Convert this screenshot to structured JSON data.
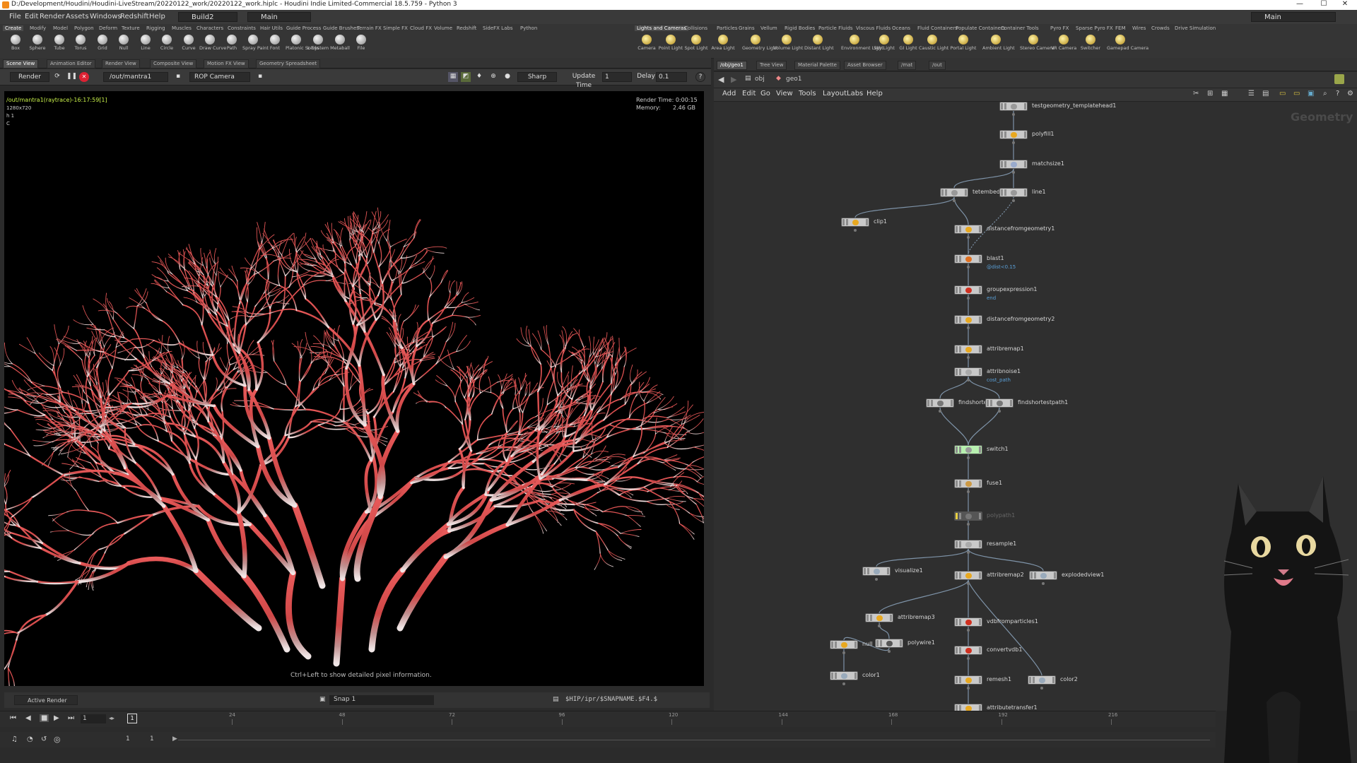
{
  "window": {
    "title": "D:/Development/Houdini/Houdini-LiveStream/20220122_work/20220122_work.hiplc - Houdini Indie Limited-Commercial 18.5.759 - Python 3",
    "minimize": "—",
    "maximize": "☐",
    "close": "✕"
  },
  "menubar": {
    "items": [
      "File",
      "Edit",
      "Render",
      "Assets",
      "Windows",
      "Redshift",
      "Help"
    ],
    "build_combo": "Build2",
    "desktop_combo": "Main",
    "right_combo": "Main"
  },
  "shelf_left": {
    "tabs": [
      "Create",
      "Modify",
      "Model",
      "Polygon",
      "Deform",
      "Texture",
      "Rigging",
      "Muscles",
      "Characters",
      "Constraints",
      "Hair Utils",
      "Guide Process",
      "Guide Brushes",
      "Terrain FX",
      "Simple FX",
      "Cloud FX",
      "Volume",
      "Redshift",
      "SideFX Labs",
      "Python"
    ],
    "tools": [
      "Box",
      "Sphere",
      "Tube",
      "Torus",
      "Grid",
      "Null",
      "Line",
      "Circle",
      "Curve",
      "Draw Curve",
      "Path",
      "Spray Paint",
      "Font",
      "Platonic Solids",
      "L-System",
      "Metaball",
      "File"
    ]
  },
  "shelf_right": {
    "tabs": [
      "Lights and Cameras",
      "Collisions",
      "Particles",
      "Grains",
      "Vellum",
      "Rigid Bodies",
      "Particle Fluids",
      "Viscous Fluids",
      "Oceans",
      "Fluid Containers",
      "Populate Containers",
      "Container Tools",
      "Pyro FX",
      "Sparse Pyro FX",
      "FEM",
      "Wires",
      "Crowds",
      "Drive Simulation"
    ],
    "tools": [
      "Camera",
      "Point Light",
      "Spot Light",
      "Area Light",
      "Geometry Light",
      "Volume Light",
      "Distant Light",
      "Environment Light",
      "Sky Light",
      "GI Light",
      "Caustic Light",
      "Portal Light",
      "Ambient Light",
      "Stereo Camera",
      "VR Camera",
      "Switcher",
      "Gamepad Camera"
    ]
  },
  "left_pane_tabs": [
    "Scene View",
    "Animation Editor",
    "Render View",
    "Composite View",
    "Motion FX View",
    "Geometry Spreadsheet"
  ],
  "viewer_toolbar": {
    "render_button": "Render",
    "output_combo": "/out/mantra1",
    "camera_combo": "ROP Camera",
    "sharp_combo": "Sharp",
    "update_time_label": "Update Time",
    "update_time_value": "1",
    "delay_label": "Delay",
    "delay_value": "0.1",
    "help": "?"
  },
  "viewport": {
    "render_path": "/out/mantra1(raytrace)-16:17:59[1]",
    "resolution": "1280x720",
    "h_line": "h 1",
    "c_line": "C",
    "render_time": "Render Time: 0:00:15",
    "memory_label": "Memory:",
    "memory_value": "2.46 GB",
    "hint": "Ctrl+Left to show detailed pixel information."
  },
  "viewer_bottom": {
    "active_render": "Active Render",
    "snap": "Snap 1",
    "snapname": "$HIP/ipr/$SNAPNAME.$F4.$"
  },
  "right_pane_tabs": [
    "/obj/geo1",
    "Tree View",
    "Material Palette",
    "Asset Browser",
    "/mat",
    "/out"
  ],
  "network": {
    "path_obj": "obj",
    "path_geo": "geo1",
    "menu": [
      "Add",
      "Edit",
      "Go",
      "View",
      "Tools",
      "Layout",
      "Labs",
      "Help"
    ],
    "context_label": "Geometry",
    "nodes": [
      "testgeometry_templatehead1",
      "polyfill1",
      "matchsize1",
      "tetembed1",
      "line1",
      "clip1",
      "distancefromgeometry1",
      "blast1",
      "groupexpression1",
      "distancefromgeometry2",
      "attribremap1",
      "attribnoise1",
      "findshortestpath2",
      "findshortestpath1",
      "switch1",
      "fuse1",
      "polypath1",
      "resample1",
      "visualize1",
      "attribremap2",
      "explodedview1",
      "attribremap3",
      "polywire1",
      "null",
      "vdbfromparticles1",
      "convertvdb1",
      "color1",
      "remesh1",
      "color2",
      "attributetransfer1"
    ],
    "sub_labels": {
      "blast1": "@dist<0.15",
      "groupexpression1": "end",
      "attribnoise1": "cost_path"
    }
  },
  "timeline": {
    "current_frame": "1",
    "start": "1",
    "end": "1",
    "ticks": [
      "24",
      "48",
      "72",
      "96",
      "120",
      "144",
      "168",
      "192",
      "216"
    ]
  },
  "colors": {
    "accent": "#f28a1a",
    "switch_node": "#b8f0b0",
    "bypass_node": "#e8d040",
    "render_red": "#e24a4a"
  }
}
